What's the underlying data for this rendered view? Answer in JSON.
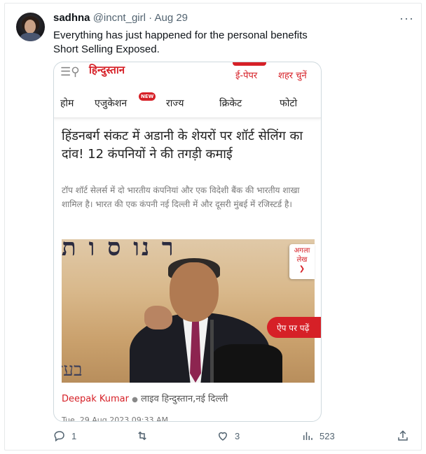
{
  "tweet": {
    "author_name": "sadhna",
    "handle": "@incnt_girl",
    "separator": "·",
    "date": "Aug 29",
    "more_icon": "more-horizontal-icon",
    "text_line1": "Everything has just happened for the personal benefits",
    "text_line2": "Short Selling Exposed."
  },
  "article": {
    "brand": "हिन्दुस्तान",
    "epaper": "ई-पेपर",
    "city": "शहर चुनें",
    "nav": [
      "होम",
      "एजुकेशन",
      "राज्य",
      "क्रिकेट",
      "फोटो"
    ],
    "new_badge": "NEW",
    "headline": "हिंडनबर्ग संकट में अडानी के शेयरों पर शॉर्ट सेलिंग का दांव! 12 कंपनियों ने की तगड़ी कमाई",
    "summary": "टॉप शॉर्ट सेलर्स में दो भारतीय कंपनियां और एक विदेशी बैंक की भारतीय शाखा शामिल है। भारत की एक कंपनी नई दिल्ली में और दूसरी मुंबई में रजिस्टर्ड है।",
    "next_article_line1": "अगला",
    "next_article_line2": "लेख",
    "read_in_app": "ऐप पर पढ़ें",
    "author": "Deepak Kumar",
    "bullet": "●",
    "source": "लाइव हिन्दुस्तान,नई दिल्ली",
    "timestamp": "Tue, 29 Aug 2023 09:33 AM"
  },
  "actions": {
    "replies": "1",
    "retweets": "",
    "likes": "3",
    "views": "523"
  },
  "colors": {
    "brand_red": "#d62027",
    "secondary_text": "#536471"
  }
}
